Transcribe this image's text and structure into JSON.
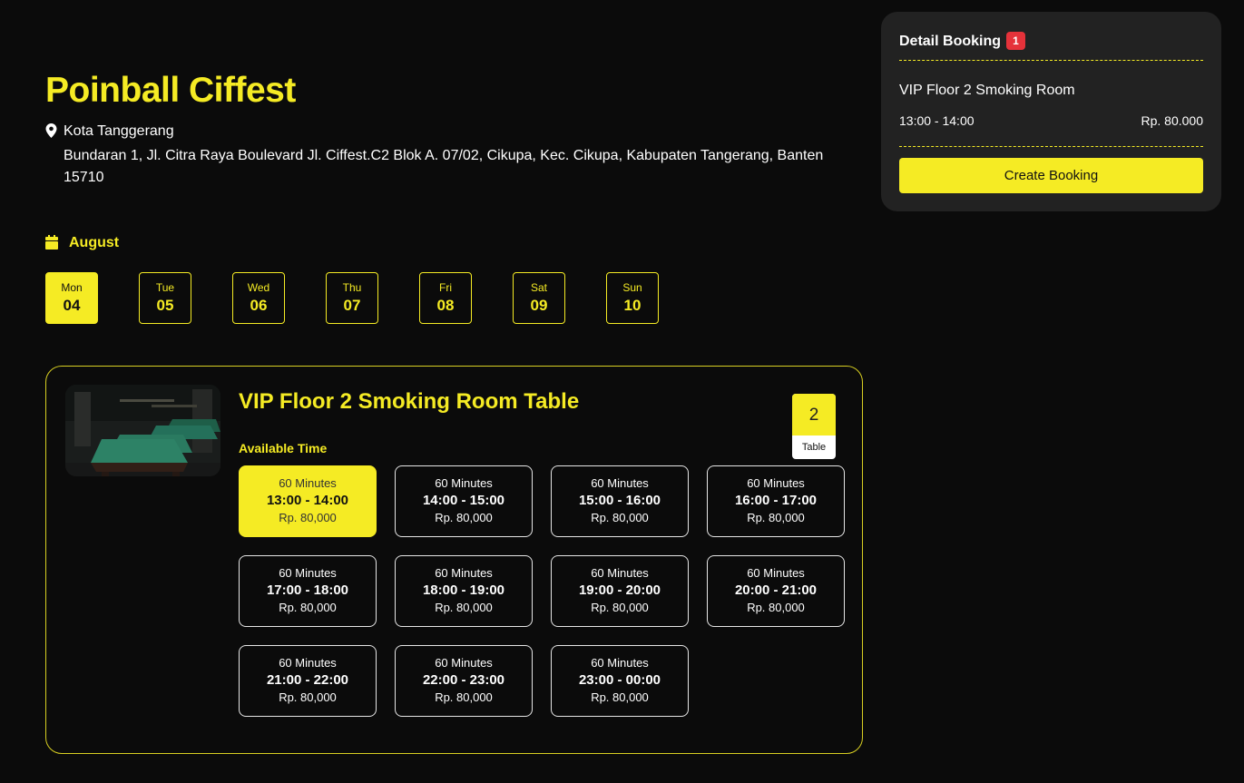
{
  "venue": {
    "name": "Poinball Ciffest",
    "city": "Kota Tanggerang",
    "address": "Bundaran 1, Jl. Citra Raya Boulevard Jl. Ciffest.C2 Blok A. 07/02, Cikupa, Kec. Cikupa, Kabupaten Tangerang, Banten 15710"
  },
  "calendar": {
    "month": "August",
    "days": [
      {
        "name": "Mon",
        "num": "04",
        "selected": true
      },
      {
        "name": "Tue",
        "num": "05",
        "selected": false
      },
      {
        "name": "Wed",
        "num": "06",
        "selected": false
      },
      {
        "name": "Thu",
        "num": "07",
        "selected": false
      },
      {
        "name": "Fri",
        "num": "08",
        "selected": false
      },
      {
        "name": "Sat",
        "num": "09",
        "selected": false
      },
      {
        "name": "Sun",
        "num": "10",
        "selected": false
      }
    ]
  },
  "room": {
    "title": "VIP Floor 2 Smoking Room Table",
    "available_label": "Available Time",
    "table_count": "2",
    "table_unit": "Table",
    "slots": [
      {
        "duration": "60 Minutes",
        "time": "13:00 - 14:00",
        "price": "Rp. 80,000",
        "selected": true
      },
      {
        "duration": "60 Minutes",
        "time": "14:00 - 15:00",
        "price": "Rp. 80,000",
        "selected": false
      },
      {
        "duration": "60 Minutes",
        "time": "15:00 - 16:00",
        "price": "Rp. 80,000",
        "selected": false
      },
      {
        "duration": "60 Minutes",
        "time": "16:00 - 17:00",
        "price": "Rp. 80,000",
        "selected": false
      },
      {
        "duration": "60 Minutes",
        "time": "17:00 - 18:00",
        "price": "Rp. 80,000",
        "selected": false
      },
      {
        "duration": "60 Minutes",
        "time": "18:00 - 19:00",
        "price": "Rp. 80,000",
        "selected": false
      },
      {
        "duration": "60 Minutes",
        "time": "19:00 - 20:00",
        "price": "Rp. 80,000",
        "selected": false
      },
      {
        "duration": "60 Minutes",
        "time": "20:00 - 21:00",
        "price": "Rp. 80,000",
        "selected": false
      },
      {
        "duration": "60 Minutes",
        "time": "21:00 - 22:00",
        "price": "Rp. 80,000",
        "selected": false
      },
      {
        "duration": "60 Minutes",
        "time": "22:00 - 23:00",
        "price": "Rp. 80,000",
        "selected": false
      },
      {
        "duration": "60 Minutes",
        "time": "23:00 - 00:00",
        "price": "Rp. 80,000",
        "selected": false
      }
    ]
  },
  "detail": {
    "title": "Detail Booking",
    "count": "1",
    "item_name": "VIP Floor 2 Smoking Room",
    "item_time": "13:00 - 14:00",
    "item_price": "Rp. 80.000",
    "button_label": "Create Booking"
  },
  "icons": {
    "location": "map-pin-icon",
    "calendar": "calendar-icon"
  },
  "colors": {
    "accent": "#f5eb24",
    "background": "#0b0b0b",
    "panel": "#222222",
    "badge": "#e5323a"
  }
}
